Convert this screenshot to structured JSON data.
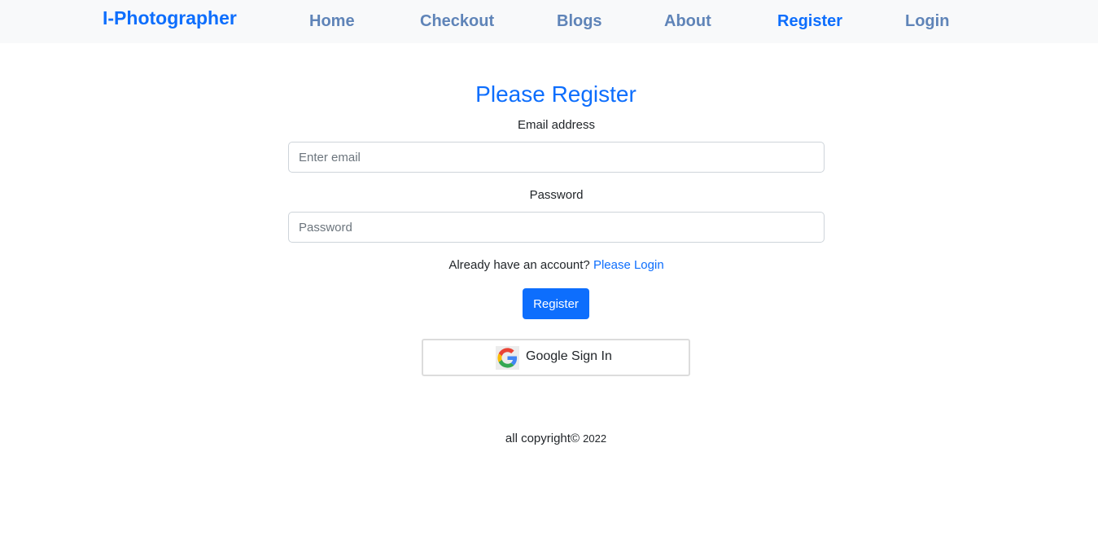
{
  "navbar": {
    "brand": "I-Photographer",
    "links": [
      {
        "label": "Home"
      },
      {
        "label": "Checkout"
      },
      {
        "label": "Blogs"
      },
      {
        "label": "About"
      },
      {
        "label": "Register",
        "active": true
      },
      {
        "label": "Login"
      }
    ]
  },
  "form": {
    "title": "Please Register",
    "email_label": "Email address",
    "email_placeholder": "Enter email",
    "email_value": "",
    "password_label": "Password",
    "password_placeholder": "Password",
    "password_value": "",
    "already_text": "Already have an account?",
    "login_link": "Please Login",
    "register_button": "Register",
    "google_button": "Google Sign In",
    "google_icon": "google-g-icon"
  },
  "footer": {
    "text": "all copyright©",
    "year": "2022"
  },
  "colors": {
    "accent": "#0d6efd",
    "nav_link": "#5f84b8",
    "navbar_bg": "#f8f9fa"
  }
}
